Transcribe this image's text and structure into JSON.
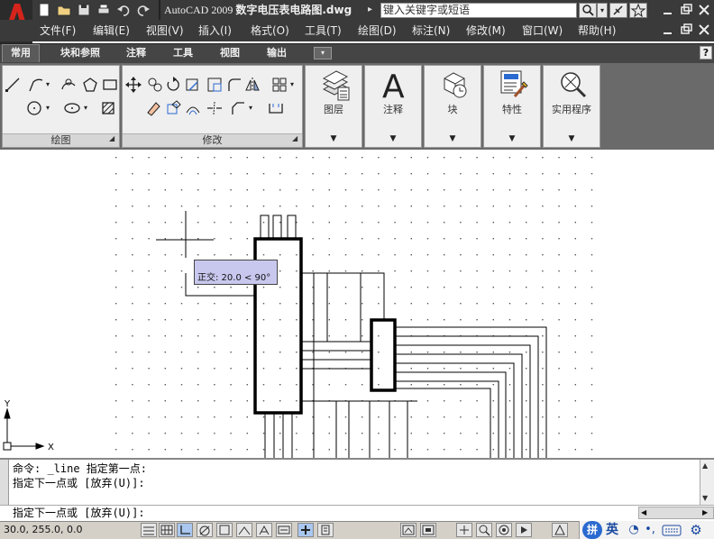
{
  "app": {
    "logo_letter": "A",
    "product": "AutoCAD 2009",
    "filename": "数字电压表电路图.dwg",
    "search_placeholder": "键入关键字或短语"
  },
  "quick_access": [
    {
      "name": "new-file-icon",
      "glyph": "▭"
    },
    {
      "name": "open-file-icon",
      "glyph": "📂"
    },
    {
      "name": "save-icon",
      "glyph": "💾"
    },
    {
      "name": "plot-icon",
      "glyph": "🖶"
    },
    {
      "name": "undo-icon",
      "glyph": "↶"
    },
    {
      "name": "redo-icon",
      "glyph": "↷"
    }
  ],
  "menu": [
    "文件(F)",
    "编辑(E)",
    "视图(V)",
    "插入(I)",
    "格式(O)",
    "工具(T)",
    "绘图(D)",
    "标注(N)",
    "修改(M)",
    "窗口(W)",
    "帮助(H)"
  ],
  "ribbon_tabs": [
    "常用",
    "块和参照",
    "注释",
    "工具",
    "视图",
    "输出"
  ],
  "panels": {
    "draw": "绘图",
    "modify": "修改",
    "layers": "图层",
    "annotation": "注释",
    "block": "块",
    "properties": "特性",
    "utilities": "实用程序"
  },
  "tooltip": {
    "text": "正交: 20.0 < 90°"
  },
  "ucs": {
    "x": "X",
    "y": "Y"
  },
  "command": {
    "line1": "命令: _line 指定第一点:",
    "line2": "指定下一点或 [放弃(U)]:",
    "prompt": "指定下一点或 [放弃(U)]:"
  },
  "status": {
    "coords": "30.0, 255.0, 0.0"
  },
  "ime": {
    "mode": "英",
    "glyph": "拼"
  },
  "colors": {
    "accent_red": "#d4241c",
    "title_bg": "#3a3a3a",
    "ribbon_panel": "#efefef",
    "tooltip_bg": "#c8c8ef"
  }
}
